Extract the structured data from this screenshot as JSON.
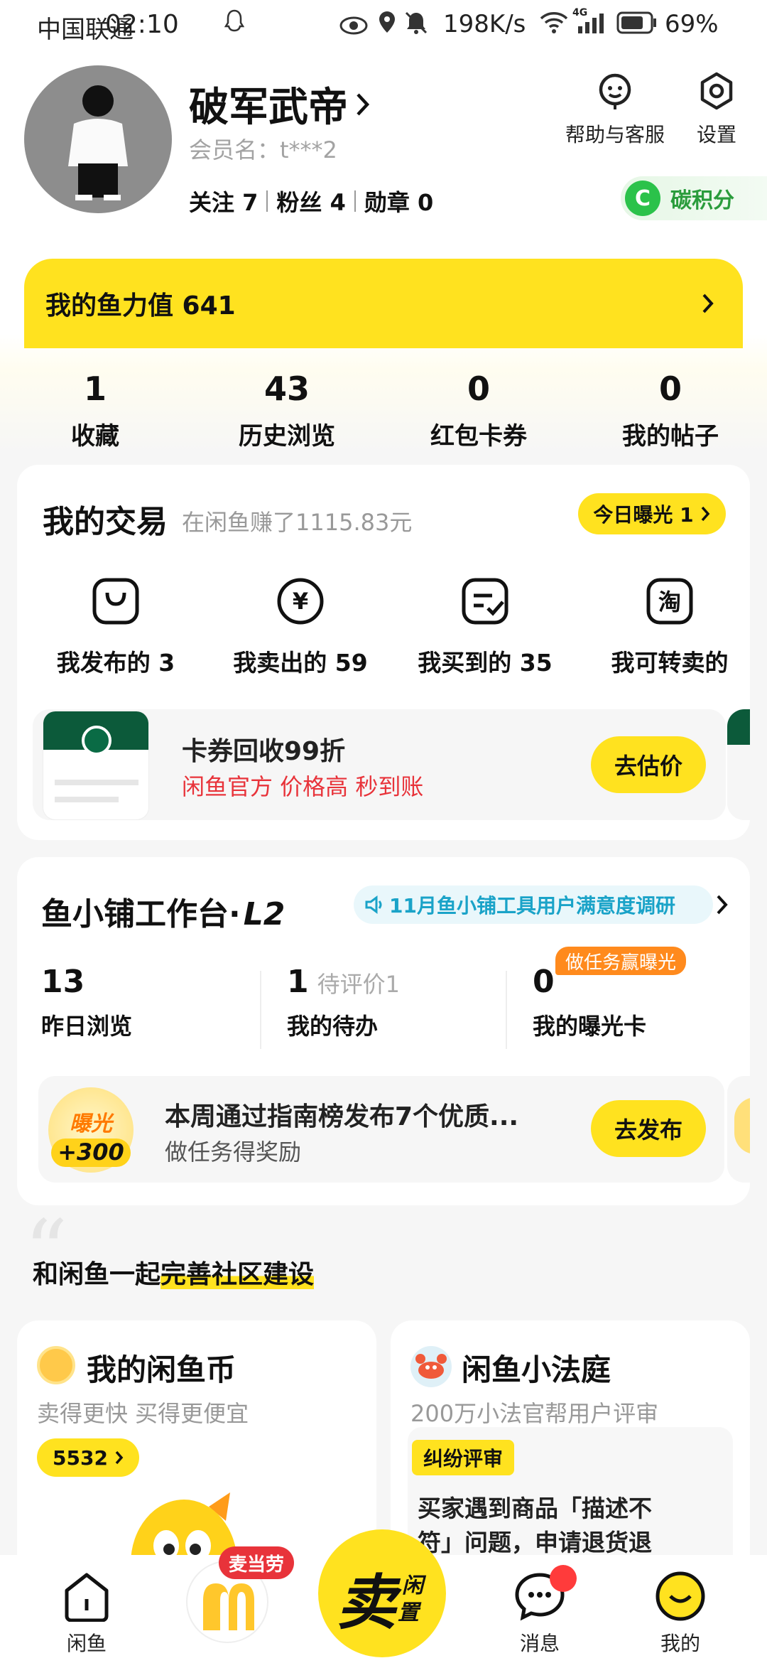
{
  "status": {
    "carrier": "中国联通",
    "time": "02:10",
    "speed": "198K/s",
    "net": "4G",
    "battery": "69%"
  },
  "profile": {
    "name": "破军武帝",
    "member_label": "会员名：t***2",
    "follow": "关注 7",
    "fans": "粉丝 4",
    "medal": "勋章 0",
    "help": "帮助与客服",
    "settings": "设置",
    "carbon": "碳积分",
    "carbon_badge": "C"
  },
  "fish_power": {
    "label": "我的鱼力值 641"
  },
  "stats": [
    {
      "num": "1",
      "label": "收藏"
    },
    {
      "num": "43",
      "label": "历史浏览"
    },
    {
      "num": "0",
      "label": "红包卡券"
    },
    {
      "num": "0",
      "label": "我的帖子"
    }
  ],
  "trade": {
    "title": "我的交易",
    "earned": "在闲鱼赚了1115.83元",
    "exposure": "今日曝光 1",
    "items": [
      {
        "label": "我发布的 3",
        "icon": "bag-icon"
      },
      {
        "label": "我卖出的 59",
        "icon": "yuan-icon"
      },
      {
        "label": "我买到的 35",
        "icon": "receipt-check-icon"
      },
      {
        "label": "我可转卖的",
        "icon": "taobao-icon"
      }
    ],
    "glyph_tao": "淘",
    "glyph_yuan": "¥",
    "promo_title": "卡券回收99折",
    "promo_sub": "闲鱼官方 价格高 秒到账",
    "promo_btn": "去估价"
  },
  "shop": {
    "title": "鱼小铺工作台·",
    "level": "L2",
    "survey": "11月鱼小铺工具用户满意度调研",
    "metrics": [
      {
        "num": "13",
        "extra": "",
        "label": "昨日浏览"
      },
      {
        "num": "1",
        "extra": "待评价1",
        "label": "我的待办"
      },
      {
        "num": "0",
        "extra": "",
        "label": "我的曝光卡"
      }
    ],
    "task_tag": "做任务赢曝光",
    "task_title": "本周通过指南榜发布7个优质...",
    "task_sub": "做任务得奖励",
    "task_btn": "去发布",
    "badge_top": "曝光",
    "badge_bottom": "+300"
  },
  "community": {
    "prefix": "和闲鱼一起",
    "highlight": "完善社区建设"
  },
  "coin": {
    "title": "我的闲鱼币",
    "sub": "卖得更快 买得更便宜",
    "value": "5532"
  },
  "court": {
    "title": "闲鱼小法庭",
    "sub": "200万小法官帮用户评审",
    "tag": "纠纷评审",
    "text1": "买家遇到商品「描述不",
    "text2": "符」问题，申请退货退"
  },
  "tabbar": {
    "home": "闲鱼",
    "ad_tag": "麦当劳",
    "sell": "卖",
    "sell_small1": "闲",
    "sell_small2": "置",
    "msg": "消息",
    "mine": "我的"
  },
  "colors": {
    "accent": "#ffe21f",
    "red": "#e8333a",
    "green": "#2bc24a"
  }
}
